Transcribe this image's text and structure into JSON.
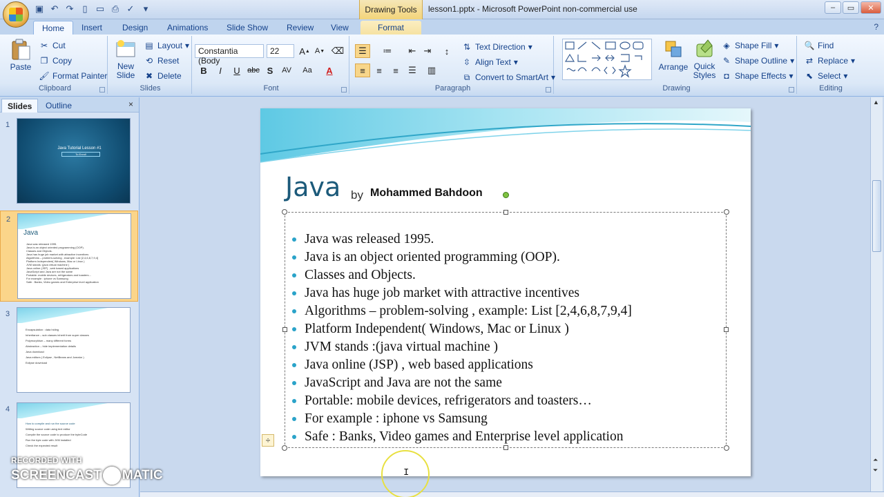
{
  "window": {
    "contextual_tab": "Drawing Tools",
    "title": "lesson1.pptx - Microsoft PowerPoint non-commercial use"
  },
  "ribbon_tabs": [
    "Home",
    "Insert",
    "Design",
    "Animations",
    "Slide Show",
    "Review",
    "View",
    "Format"
  ],
  "clipboard": {
    "paste": "Paste",
    "cut": "Cut",
    "copy": "Copy",
    "format_painter": "Format Painter",
    "label": "Clipboard"
  },
  "slides_group": {
    "new_slide": "New Slide",
    "layout": "Layout",
    "reset": "Reset",
    "delete": "Delete",
    "label": "Slides"
  },
  "font": {
    "name": "Constantia (Body",
    "size": "22",
    "label": "Font"
  },
  "paragraph": {
    "text_direction": "Text Direction",
    "align_text": "Align Text",
    "convert_smartart": "Convert to SmartArt",
    "label": "Paragraph"
  },
  "drawing": {
    "arrange": "Arrange",
    "quick_styles": "Quick Styles",
    "shape_fill": "Shape Fill",
    "shape_outline": "Shape Outline",
    "shape_effects": "Shape Effects",
    "label": "Drawing"
  },
  "editing": {
    "find": "Find",
    "replace": "Replace",
    "select": "Select",
    "label": "Editing"
  },
  "panel": {
    "tab_slides": "Slides",
    "tab_outline": "Outline",
    "close": "×"
  },
  "thumbnails": [
    {
      "num": "1",
      "title": "Java Tutorial Lesson #1",
      "subtitle": "To Enroll"
    },
    {
      "num": "2",
      "title": "Java",
      "lines": [
        "Java was released 1995.",
        "Java is an object oriented programming (OOP).",
        "Classes and Objects.",
        "Java has huge job market with attractive incentives",
        "Algorithms – problem-solving , example: List [2,4,6,8,7,9,4]",
        "Platform Independent( Windows, Mac or Linux )",
        "JVM stands :(java virtual machine )",
        "Java online (JSP) , web based applications",
        "JavaScript and Java are not the same",
        "Portable: mobile devices, refrigerators and toasters…",
        "For example : iphone vs Samsung",
        "Safe : Banks, Video games and Enterprise level application"
      ]
    },
    {
      "num": "3",
      "lines": [
        "Encapsulation : data hiding",
        "Inheritance – sub classes inherit from super classes",
        "Polymorphism – many different forms",
        "Abstraction – hide implementation details",
        "Java download",
        "Java editors ( Eclipse , NetBeans and Jcreator )",
        "Eclipse download"
      ]
    },
    {
      "num": "4",
      "lines": [
        "How to compile and run the source code",
        "Writing source code using text editor",
        "Compile the source code to produce the byteCode",
        "Run the byte code with JVM installed",
        "Check the expected result"
      ]
    }
  ],
  "slide": {
    "title": "Java",
    "by": "by",
    "author": "Mohammed Bahdoon",
    "bullets": [
      "Java was  released 1995.",
      "Java is  an object oriented programming (OOP).",
      "Classes and Objects.",
      "Java has huge job market with attractive incentives",
      "Algorithms – problem-solving  , example: List [2,4,6,8,7,9,4]",
      "Platform Independent( Windows, Mac  or  Linux )",
      "JVM stands :(java virtual machine )",
      "Java online (JSP) , web based applications",
      "JavaScript and Java are not the same",
      "Portable: mobile devices, refrigerators and toasters…",
      "For example : iphone vs Samsung",
      "Safe : Banks, Video games and Enterprise level application"
    ]
  },
  "watermark": {
    "line1": "RECORDED WITH",
    "line2a": "SCREENCAST",
    "line2b": "MATIC"
  },
  "colors": {
    "accent": "#2aa3c9",
    "title": "#1c5a7a",
    "ribbon": "#dbe8f7"
  }
}
